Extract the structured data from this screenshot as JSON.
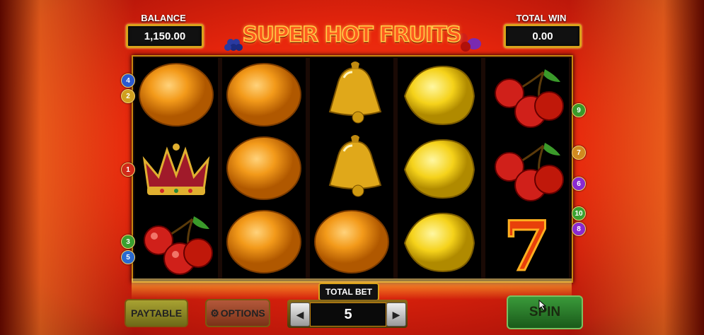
{
  "balance": {
    "label": "BALANCE",
    "value": "1,150.00"
  },
  "total_win": {
    "label": "TOTAL WIN",
    "value": "0.00"
  },
  "logo": {
    "text": "SUPER HOT FRUITS"
  },
  "reels": [
    [
      "orange",
      "crown",
      "cherries"
    ],
    [
      "orange",
      "orange",
      "orange"
    ],
    [
      "bell",
      "bell",
      "orange"
    ],
    [
      "lemon",
      "lemon",
      "lemon"
    ],
    [
      "cherries",
      "cherries",
      "seven"
    ]
  ],
  "paylines_left": [
    {
      "number": "4",
      "color": "#2a5ad0"
    },
    {
      "number": "2",
      "color": "#d0a020"
    },
    {
      "number": "1",
      "color": "#d02a1a"
    },
    {
      "number": "3",
      "color": "#3aa030"
    },
    {
      "number": "5",
      "color": "#2a6ad0"
    }
  ],
  "paylines_right": [
    {
      "number": "9",
      "color": "#3a9a2a"
    },
    {
      "number": "7",
      "color": "#d08a20"
    },
    {
      "number": "6",
      "color": "#8a2ad0"
    },
    {
      "number": "10",
      "color": "#3aa030"
    },
    {
      "number": "8",
      "color": "#8a2ad0"
    }
  ],
  "buttons": {
    "paytable": "PAYTABLE",
    "options": "OPTIONS",
    "spin": "SPIN"
  },
  "bet": {
    "label": "TOTAL BET",
    "value": "5"
  }
}
